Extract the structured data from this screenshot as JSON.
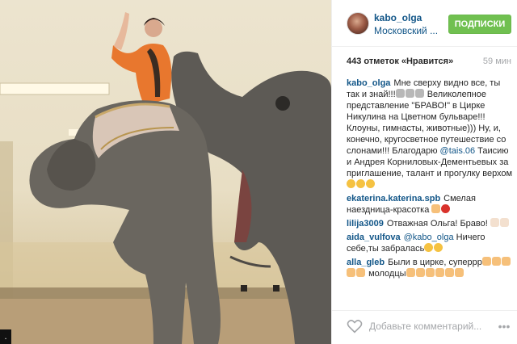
{
  "post": {
    "username": "kabo_olga",
    "location": "Московский ...",
    "follow_label": "ПОДПИСКИ",
    "likes_text": "443 отметок «Нравится»",
    "time_ago": "59 мин"
  },
  "caption": {
    "user": "kabo_olga",
    "text_1": "Мне сверху видно все, ты так и знай!!!",
    "text_2": "Великолепное представление \"БРАВО!\" в Цирке Никулина на Цветном бульваре!!! Клоуны, гимнасты, животные))) Ну, и, конечно, кругосветное путешествие со слонами!!! Благодарю",
    "tag": "@tais.06",
    "text_3": "Таисию и Андрея Корниловых-Дементьевых за приглашение, талант и прогулку верхом"
  },
  "comments": [
    {
      "user": "ekaterina.katerina.spb",
      "text": "Смелая наездница-красотка"
    },
    {
      "user": "lilija3009",
      "text": "Отважная Ольга! Браво!"
    },
    {
      "user": "aida_vulfova",
      "tag": "@kabo_olga",
      "text": "Ничего себе,ты забралась"
    },
    {
      "user": "alla_gleb",
      "text_1": "Были в цирке, суперрр",
      "text_2": "молодцы"
    }
  ],
  "composer": {
    "placeholder": "Добавьте комментарий...",
    "more": "•••"
  },
  "photo": {
    "badge": "."
  },
  "icons": {
    "heart": "heart-icon",
    "more": "more-options-icon",
    "avatar": "user-avatar"
  },
  "colors": {
    "link": "#125688",
    "follow_button": "#70c050",
    "muted": "#a5a7aa"
  }
}
